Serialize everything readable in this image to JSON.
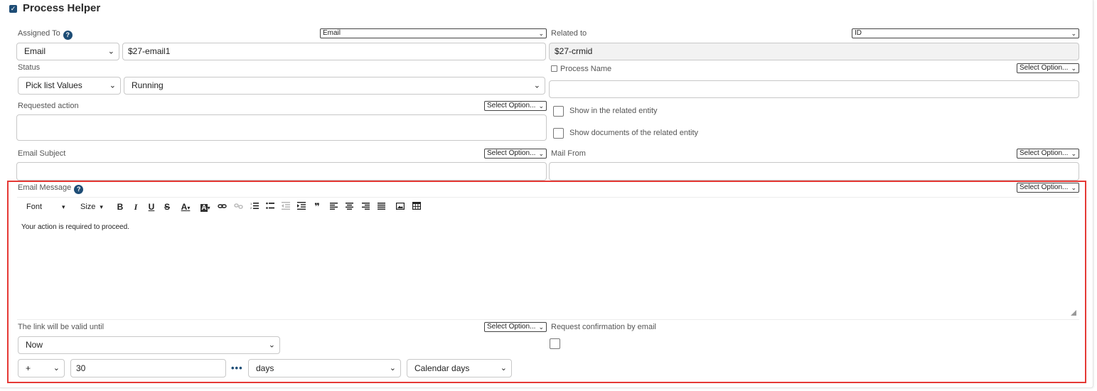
{
  "header": {
    "title": "Process Helper"
  },
  "assigned_to": {
    "label": "Assigned To",
    "type_select": "Email",
    "mode_select": "Email",
    "value": "$27-email1"
  },
  "related_to": {
    "label": "Related to",
    "type_select": "ID",
    "value": "$27-crmid"
  },
  "status": {
    "label": "Status",
    "mode_select": "Pick list Values",
    "value_select": "Running"
  },
  "process_name": {
    "label": "Process Name",
    "option_select": "Select Option...",
    "value": ""
  },
  "requested_action": {
    "label": "Requested action",
    "option_select": "Select Option...",
    "value": ""
  },
  "show_related": {
    "label": "Show in the related entity"
  },
  "show_documents": {
    "label": "Show documents of the related entity"
  },
  "email_subject": {
    "label": "Email Subject",
    "option_select": "Select Option...",
    "value": ""
  },
  "mail_from": {
    "label": "Mail From",
    "option_select": "Select Option...",
    "value": ""
  },
  "email_message": {
    "label": "Email Message",
    "option_select": "Select Option...",
    "toolbar": {
      "font": "Font",
      "size": "Size",
      "bold": "B",
      "italic": "I",
      "underline": "U",
      "strike": "S",
      "text_color": "A",
      "bg_color": "A",
      "quote": "❞"
    },
    "body": "Your action is required to proceed."
  },
  "link_valid": {
    "label": "The link will be valid until",
    "option_select": "Select Option...",
    "base_select": "Now",
    "operator_select": "+",
    "amount": "30",
    "unit_select": "days",
    "daytype_select": "Calendar days"
  },
  "request_confirmation": {
    "label": "Request confirmation by email"
  }
}
